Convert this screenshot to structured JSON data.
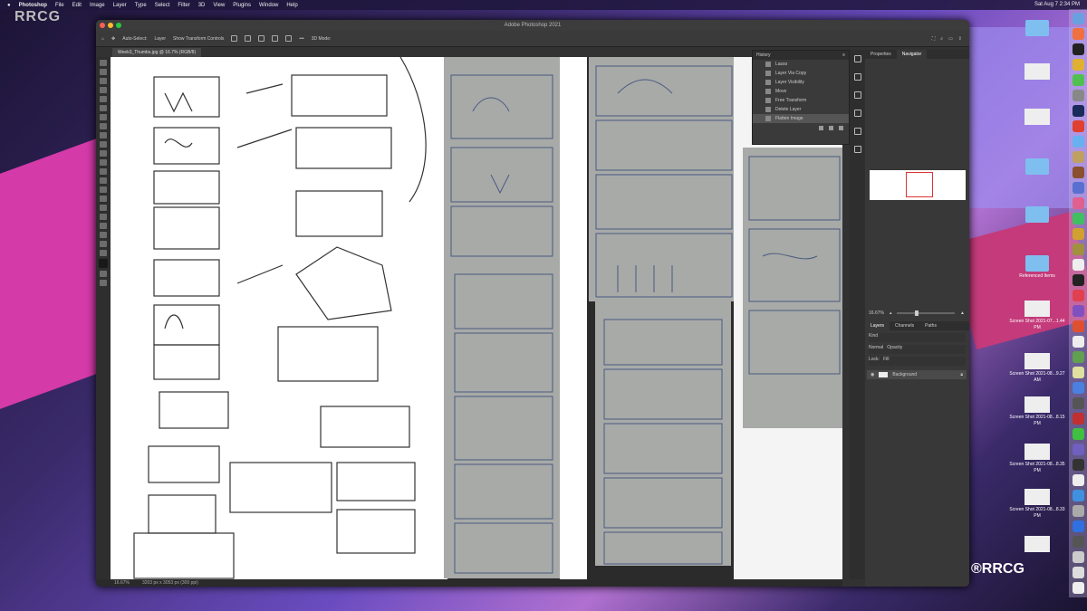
{
  "menubar": {
    "apple": "",
    "app": "Photoshop",
    "items": [
      "File",
      "Edit",
      "Image",
      "Layer",
      "Type",
      "Select",
      "Filter",
      "3D",
      "View",
      "Plugins",
      "Window",
      "Help"
    ],
    "clock": "Sat Aug 7  2:34 PM"
  },
  "watermark": "RRCG",
  "window": {
    "title": "Adobe Photoshop 2021",
    "doc_tab": "Week3_Thumbs.jpg @ 16.7% (RGB/8)"
  },
  "options": {
    "auto_select": "Auto-Select:",
    "target": "Layer",
    "show_transform": "Show Transform Controls",
    "more": "•••",
    "mode3d": "3D Mode:"
  },
  "history": {
    "title": "History",
    "items": [
      "Lasso",
      "Layer Via Copy",
      "Layer Visibility",
      "Move",
      "Free Transform",
      "Delete Layer",
      "Flatten Image"
    ],
    "selected": 6
  },
  "right_panel": {
    "tabs": [
      "Properties",
      "Navigator"
    ],
    "active": "Navigator",
    "zoom": "16.67%",
    "layer_tabs": [
      "Layers",
      "Channels",
      "Paths"
    ],
    "layer_kind": "Kind",
    "blend": "Normal",
    "opacity": "Opacity",
    "lock": "Lock:",
    "fill": "Fill",
    "layer_name": "Background"
  },
  "status": {
    "zoom": "16.67%",
    "doc_size": "3203 px x 3053 px (300 ppi)"
  },
  "desktop_items": [
    {
      "label": "",
      "type": "folder"
    },
    {
      "label": "",
      "type": "thumb"
    },
    {
      "label": "",
      "type": "doc"
    },
    {
      "label": "",
      "type": "folder"
    },
    {
      "label": "",
      "type": "folder"
    },
    {
      "label": "Referenced Items",
      "type": "folder"
    },
    {
      "label": "Screen Shot 2021-07...1.44 PM",
      "type": "thumb"
    },
    {
      "label": "Screen Shot 2021-08...9.27 AM",
      "type": "thumb"
    },
    {
      "label": "Screen Shot 2021-08...8.15 PM",
      "type": "thumb"
    },
    {
      "label": "Screen Shot 2021-08...8.35 PM",
      "type": "thumb"
    },
    {
      "label": "Screen Shot 2021-08...8.33 PM",
      "type": "thumb"
    },
    {
      "label": "",
      "type": "thumb"
    }
  ],
  "logo": "RRCG 人人素材"
}
